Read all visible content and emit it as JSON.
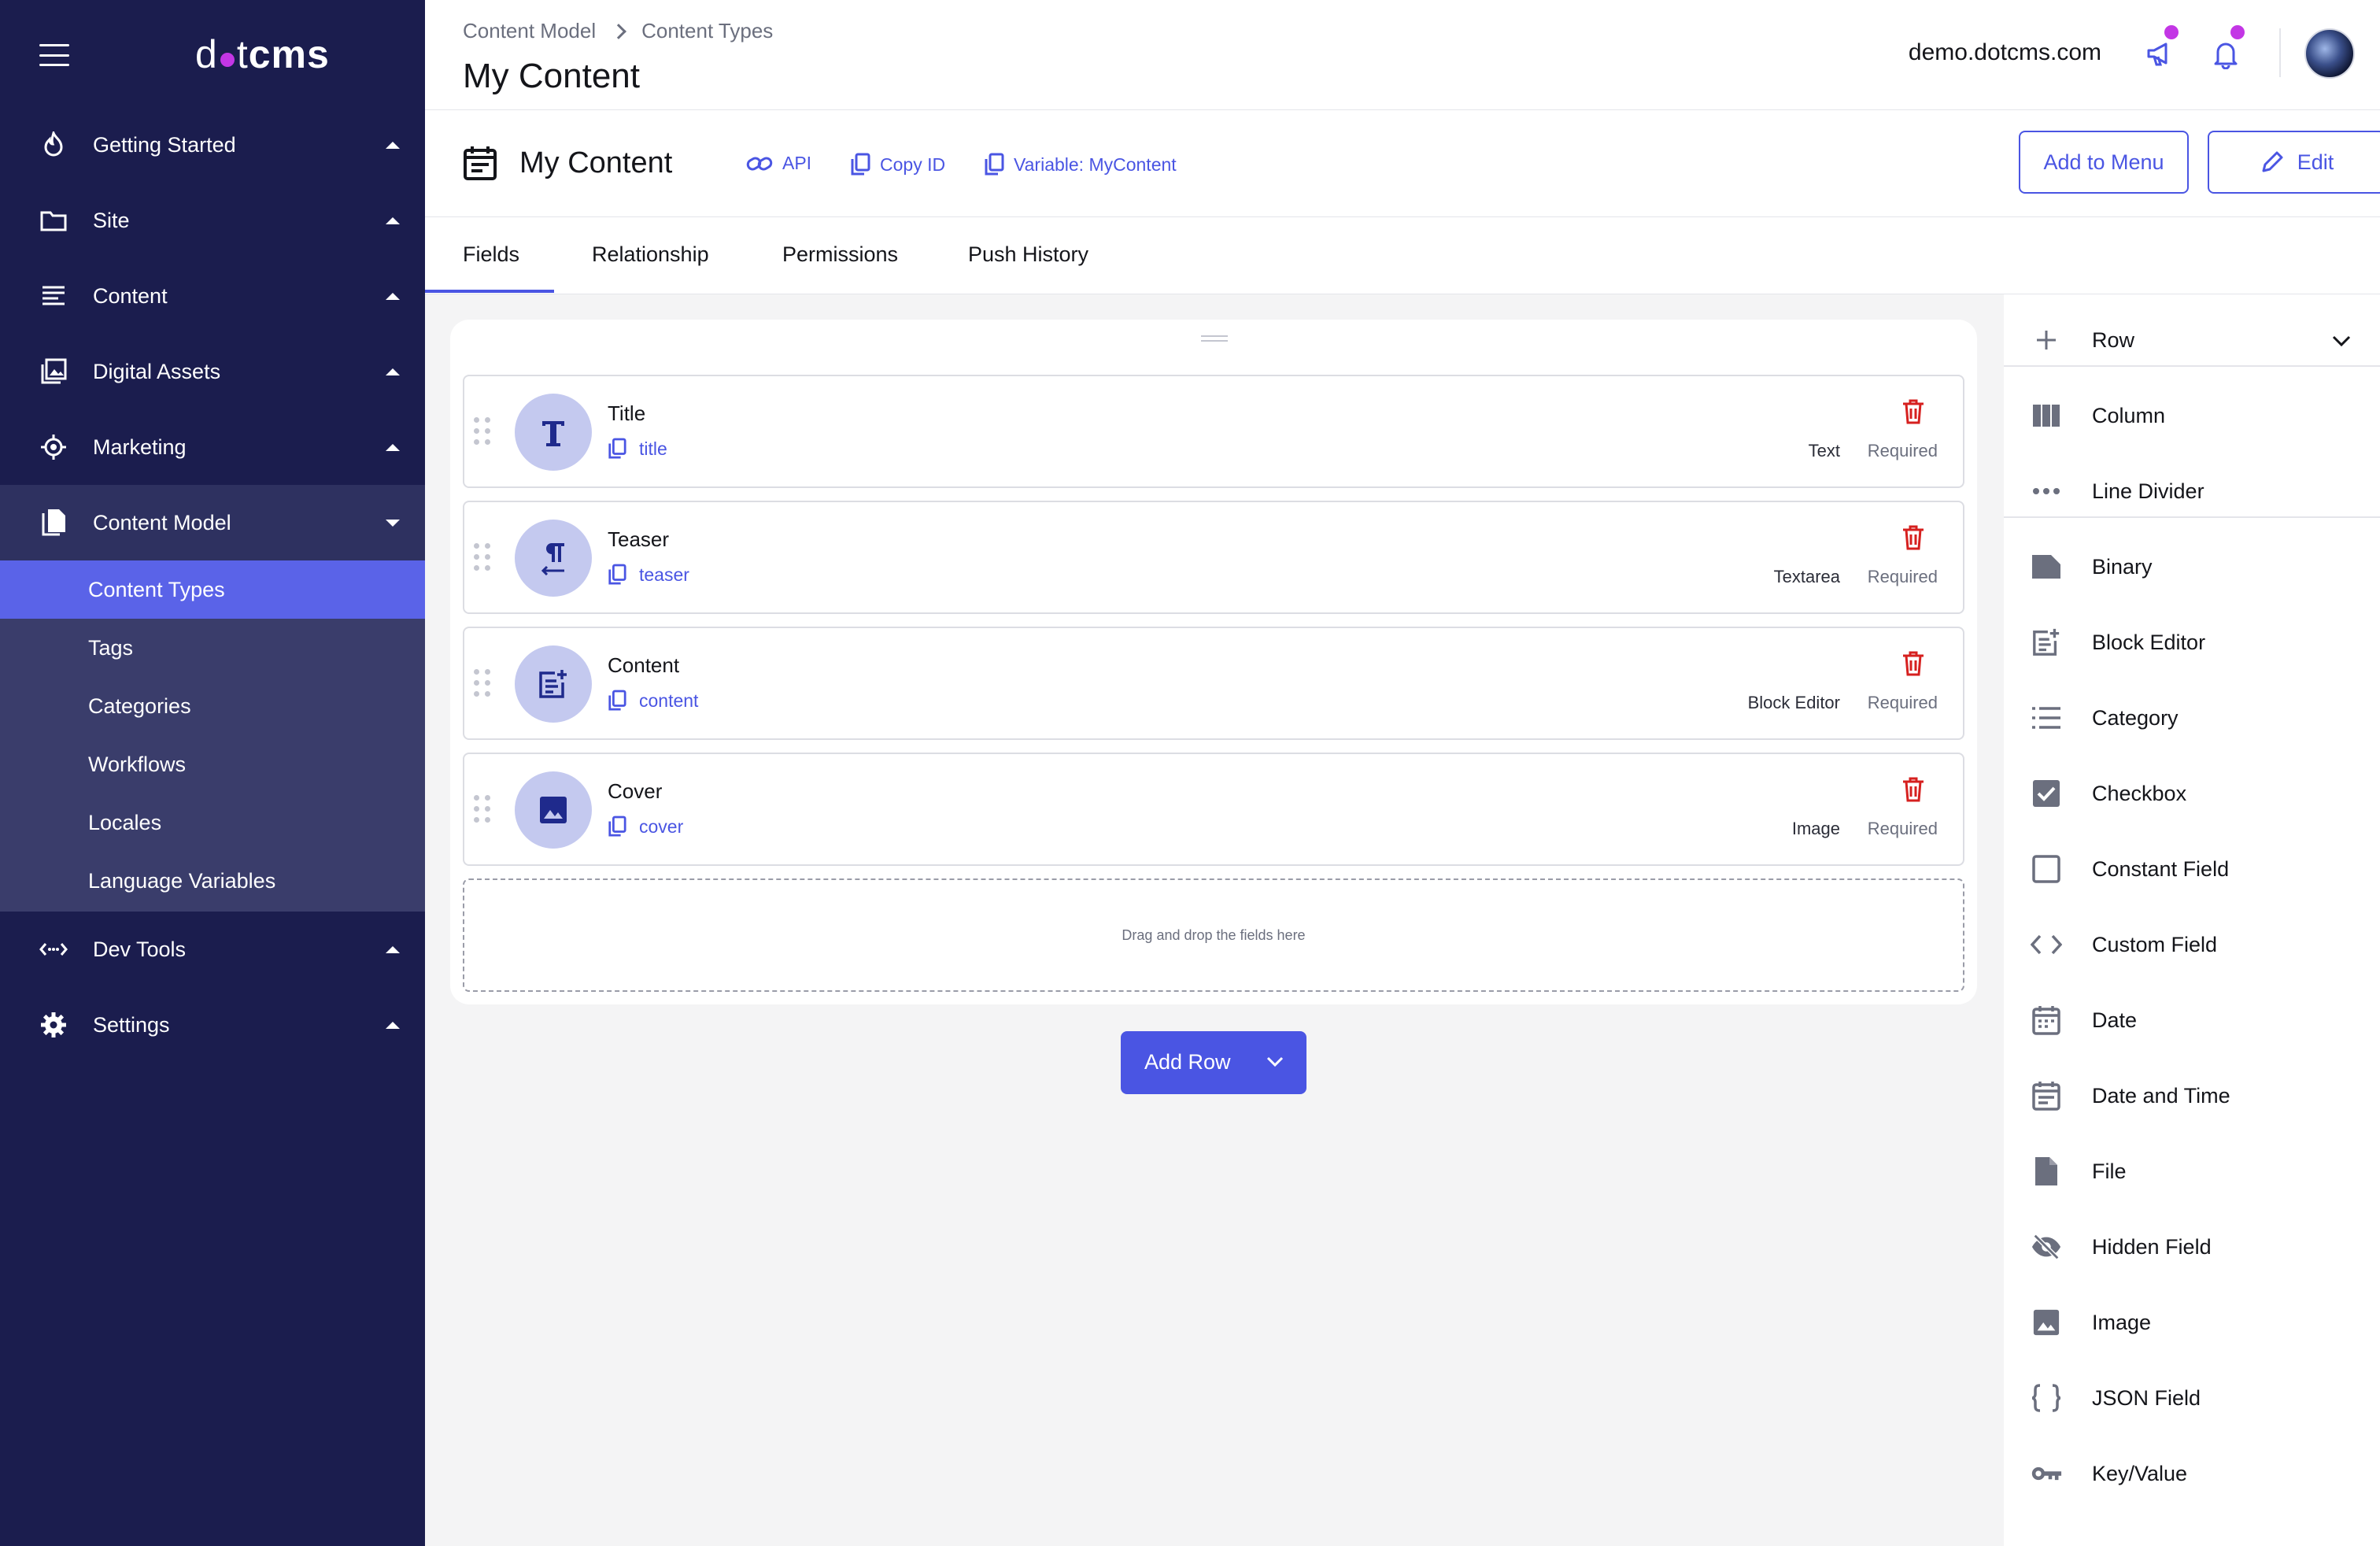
{
  "sidebar": {
    "logo": {
      "left": "d",
      "mid": "t",
      "right": "cms"
    },
    "items": [
      {
        "label": "Getting Started",
        "icon": "fire-icon"
      },
      {
        "label": "Site",
        "icon": "folder-icon"
      },
      {
        "label": "Content",
        "icon": "content-lines-icon"
      },
      {
        "label": "Digital Assets",
        "icon": "image-stack-icon"
      },
      {
        "label": "Marketing",
        "icon": "target-icon"
      },
      {
        "label": "Content Model",
        "icon": "documents-icon"
      },
      {
        "label": "Dev Tools",
        "icon": "code-arrows-icon"
      },
      {
        "label": "Settings",
        "icon": "gear-icon"
      }
    ],
    "content_model_sub": [
      "Content Types",
      "Tags",
      "Categories",
      "Workflows",
      "Locales",
      "Language Variables"
    ]
  },
  "header": {
    "breadcrumb": [
      "Content Model",
      "Content Types"
    ],
    "title": "My Content",
    "site": "demo.dotcms.com"
  },
  "content_type": {
    "name": "My Content",
    "links": {
      "api": "API",
      "copy_id": "Copy ID",
      "variable": "Variable: MyContent"
    },
    "add_to_menu": "Add to Menu",
    "edit": "Edit"
  },
  "tabs": [
    "Fields",
    "Relationship",
    "Permissions",
    "Push History"
  ],
  "fields": [
    {
      "name": "Title",
      "variable": "title",
      "type": "Text",
      "required": "Required",
      "icon": "text-t-icon"
    },
    {
      "name": "Teaser",
      "variable": "teaser",
      "type": "Textarea",
      "required": "Required",
      "icon": "paragraph-icon"
    },
    {
      "name": "Content",
      "variable": "content",
      "type": "Block Editor",
      "required": "Required",
      "icon": "block-editor-icon"
    },
    {
      "name": "Cover",
      "variable": "cover",
      "type": "Image",
      "required": "Required",
      "icon": "image-icon"
    }
  ],
  "dropzone": "Drag and drop the fields here",
  "add_row": "Add Row",
  "palette": {
    "row": "Row",
    "items": [
      "Column",
      "Line Divider",
      "Binary",
      "Block Editor",
      "Category",
      "Checkbox",
      "Constant Field",
      "Custom Field",
      "Date",
      "Date and Time",
      "File",
      "Hidden Field",
      "Image",
      "JSON Field",
      "Key/Value"
    ]
  },
  "colors": {
    "sidebar": "#1b1d4e",
    "accent": "#4a55e3",
    "notify": "#c336e5",
    "danger": "#d6201f"
  }
}
